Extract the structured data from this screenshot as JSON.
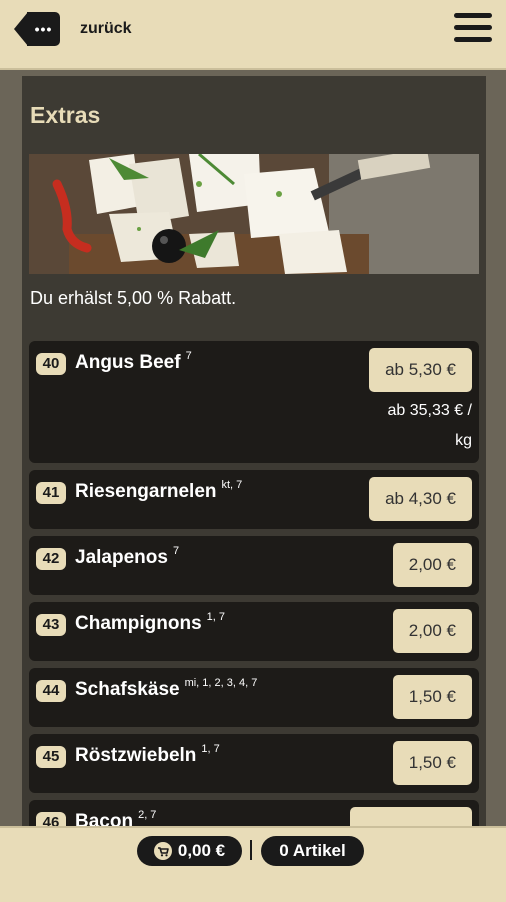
{
  "header": {
    "back_icon_text": "•••",
    "back_label": "zurück"
  },
  "section": {
    "title": "Extras",
    "image_alt": "feta-cheese-image",
    "discount_text": "Du erhälst 5,00 % Rabatt."
  },
  "items": [
    {
      "num": "40",
      "name": "Angus Beef",
      "allergens": "7",
      "price": "ab 5,30 €",
      "unit_line1": "ab 35,33 € /",
      "unit_line2": "kg"
    },
    {
      "num": "41",
      "name": "Riesengarnelen",
      "allergens": "kt, 7",
      "price": "ab 4,30 €"
    },
    {
      "num": "42",
      "name": "Jalapenos",
      "allergens": "7",
      "price": "2,00 €"
    },
    {
      "num": "43",
      "name": "Champignons",
      "allergens": "1, 7",
      "price": "2,00 €"
    },
    {
      "num": "44",
      "name": "Schafskäse",
      "allergens": "mi, 1, 2, 3, 4, 7",
      "price": "1,50 €"
    },
    {
      "num": "45",
      "name": "Röstzwiebeln",
      "allergens": "1, 7",
      "price": "1,50 €"
    },
    {
      "num": "46",
      "name": "Bacon",
      "allergens": "2, 7",
      "price": ""
    }
  ],
  "footer": {
    "cart_total": "0,00 €",
    "article_count": "0 Artikel"
  },
  "colors": {
    "accent": "#e8dcb8",
    "panel": "#3d3a33",
    "item_bg": "#1d1b18"
  }
}
